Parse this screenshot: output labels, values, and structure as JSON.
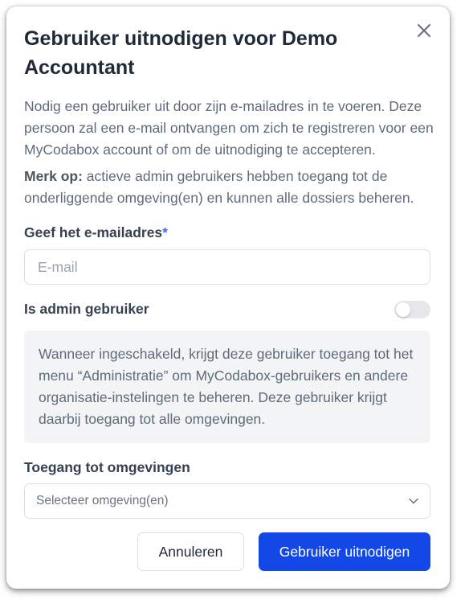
{
  "modal": {
    "title": "Gebruiker uitnodigen voor Demo Accountant",
    "description": "Nodig een gebruiker uit door zijn e-mailadres in te voeren. Deze persoon zal een e-mail ontvangen om zich te registreren voor een MyCodabox account of om de uitnodiging te accepteren.",
    "note_label": "Merk op:",
    "note_text": " actieve admin gebruikers hebben toegang tot de onderliggende omgeving(en) en kunnen alle dossiers beheren."
  },
  "email": {
    "label": "Geef het e-mailadres",
    "required_mark": "*",
    "value": "",
    "placeholder": "E-mail"
  },
  "admin": {
    "label": "Is admin gebruiker",
    "enabled": false,
    "info": "Wanneer ingeschakeld, krijgt deze gebruiker toegang tot het menu “Administratie” om MyCodabox-gebruikers en andere organisatie-instelingen te beheren. Deze gebruiker krijgt daarbij toegang tot alle omgevingen."
  },
  "environments": {
    "label": "Toegang tot omgevingen",
    "placeholder": "Selecteer omgeving(en)"
  },
  "buttons": {
    "cancel": "Annuleren",
    "submit": "Gebruiker uitnodigen"
  },
  "colors": {
    "primary": "#1448e6",
    "required": "#3b6ef5"
  },
  "icons": {
    "close": "close-icon",
    "dropdown": "chevron-down-icon"
  }
}
